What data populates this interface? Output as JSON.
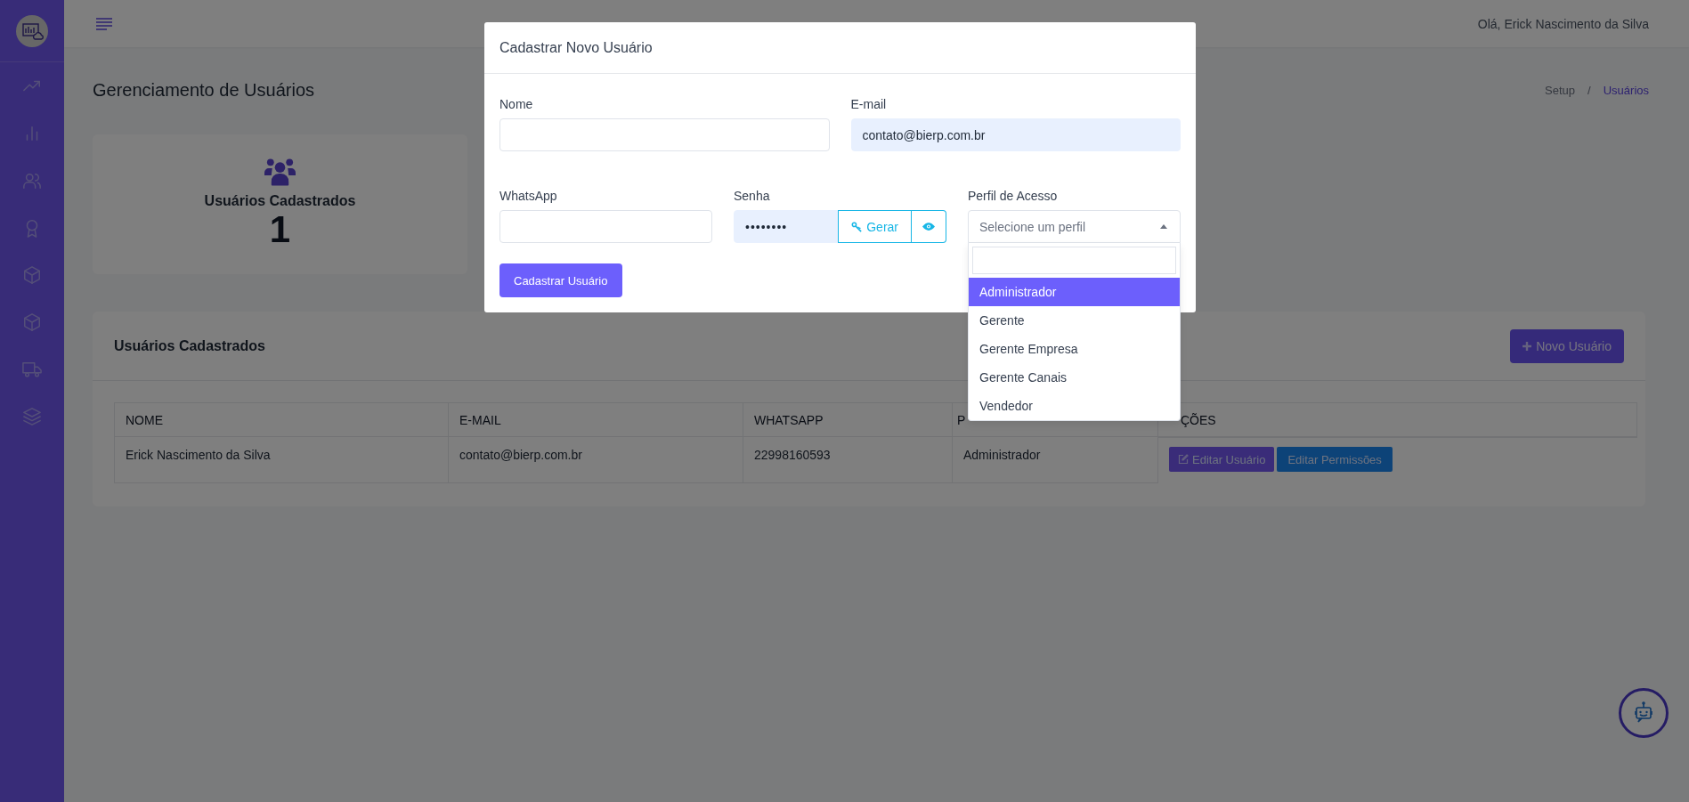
{
  "topbar": {
    "greeting": "Olá, Erick Nascimento da Silva"
  },
  "page": {
    "title": "Gerenciamento de Usuários",
    "breadcrumb": [
      "Setup",
      "Usuários"
    ],
    "separator": "/"
  },
  "stat": {
    "label": "Usuários Cadastrados",
    "value": "1"
  },
  "users_card": {
    "title": "Usuários Cadastrados",
    "new_button": "Novo Usuário",
    "table": {
      "columns": [
        "NOME",
        "E-MAIL",
        "WHATSAPP",
        "P",
        "ÇÕES"
      ],
      "rows": [
        {
          "cells": [
            "Erick Nascimento da Silva",
            "contato@bierp.com.br",
            "22998160593",
            "Administrador"
          ],
          "actions": [
            "Editar Usuário",
            "Editar Permissões"
          ]
        }
      ]
    }
  },
  "modal": {
    "title": "Cadastrar Novo Usuário",
    "name": {
      "label": "Nome"
    },
    "email": {
      "label": "E-mail",
      "value": "contato@bierp.com.br"
    },
    "whatsapp": {
      "label": "WhatsApp"
    },
    "password": {
      "label": "Senha",
      "value": "••••••••",
      "generate": "Gerar"
    },
    "profile": {
      "label": "Perfil de Acesso",
      "placeholder": "Selecione um perfil",
      "expanded": true,
      "options": [
        {
          "label": "Administrador",
          "selected": true
        },
        {
          "label": "Gerente",
          "selected": false
        },
        {
          "label": "Gerente Empresa",
          "selected": false
        },
        {
          "label": "Gerente Canais",
          "selected": false
        },
        {
          "label": "Vendedor",
          "selected": false
        }
      ]
    },
    "submit": "Cadastrar Usuário"
  }
}
